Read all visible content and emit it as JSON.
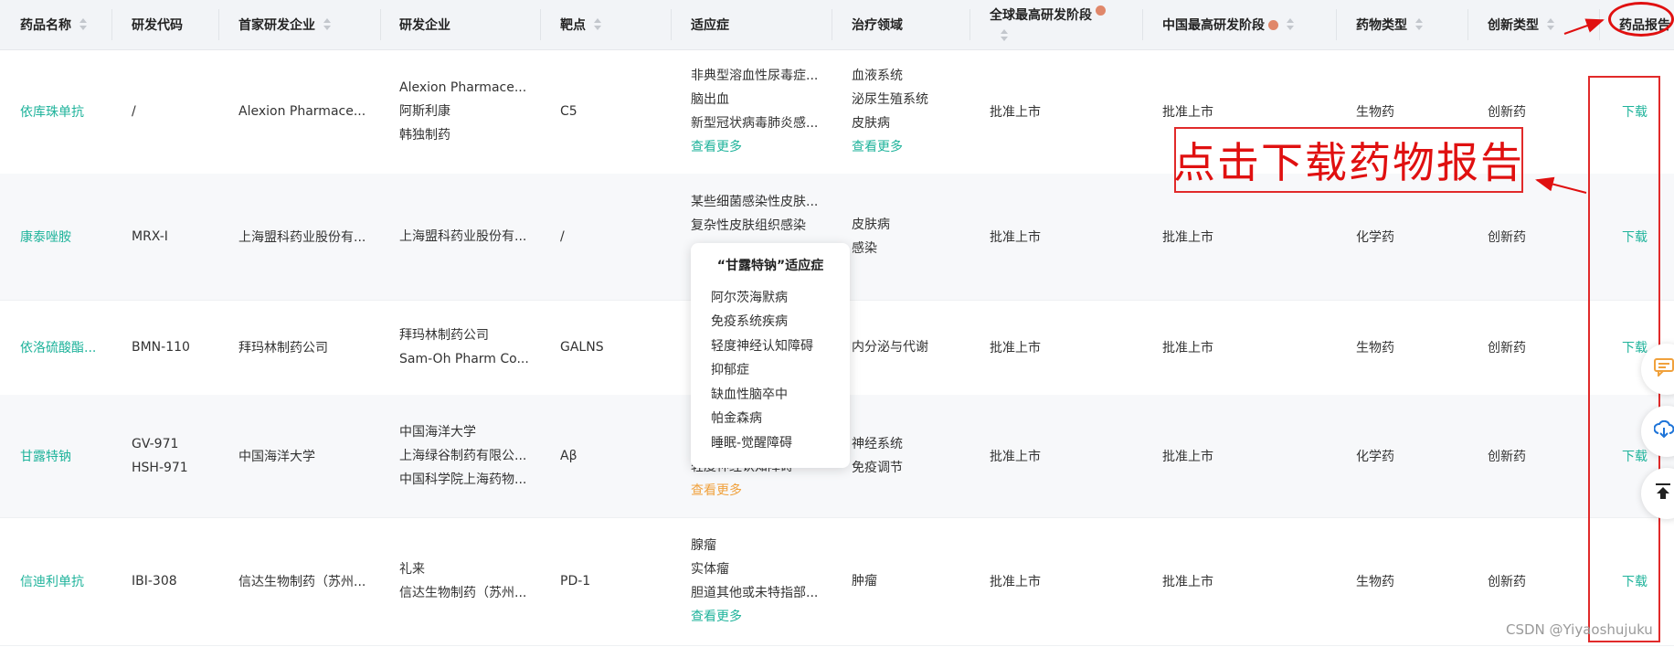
{
  "headers": {
    "name": "药品名称",
    "code": "研发代码",
    "first_company": "首家研发企业",
    "companies": "研发企业",
    "target": "靶点",
    "indication": "适应症",
    "therapy_area": "治疗领域",
    "global_stage": "全球最高研发阶段",
    "china_stage": "中国最高研发阶段",
    "drug_type": "药物类型",
    "innovation_type": "创新类型",
    "report": "药品报告"
  },
  "rows": [
    {
      "name": "依库珠单抗",
      "code": [
        "/"
      ],
      "first_company": "Alexion Pharmace...",
      "companies": [
        "Alexion Pharmace...",
        "阿斯利康",
        "韩独制药"
      ],
      "target": "C5",
      "indications": [
        "非典型溶血性尿毒症...",
        "脑出血",
        "新型冠状病毒肺炎感..."
      ],
      "indication_more": "查看更多",
      "therapy_areas": [
        "血液系统",
        "泌尿生殖系统",
        "皮肤病"
      ],
      "therapy_more": "查看更多",
      "global_stage": "批准上市",
      "china_stage": "批准上市",
      "drug_type": "生物药",
      "innovation_type": "创新药",
      "download": "下载"
    },
    {
      "name": "康泰唑胺",
      "code": [
        "MRX-I"
      ],
      "first_company": "上海盟科药业股份有...",
      "companies": [
        "上海盟科药业股份有..."
      ],
      "target": "/",
      "indications": [
        "某些细菌感染性皮肤...",
        "复杂性皮肤组织感染"
      ],
      "indication_more": "",
      "therapy_areas": [
        "皮肤病",
        "感染"
      ],
      "therapy_more": "",
      "global_stage": "批准上市",
      "china_stage": "批准上市",
      "drug_type": "化学药",
      "innovation_type": "创新药",
      "download": "下载"
    },
    {
      "name": "依洛硫酸酯...",
      "code": [
        "BMN-110"
      ],
      "first_company": "拜玛林制药公司",
      "companies": [
        "拜玛林制药公司",
        "Sam-Oh Pharm Co..."
      ],
      "target": "GALNS",
      "indications": [],
      "indication_more": "",
      "therapy_areas": [
        "内分泌与代谢"
      ],
      "therapy_more": "",
      "global_stage": "批准上市",
      "china_stage": "批准上市",
      "drug_type": "生物药",
      "innovation_type": "创新药",
      "download": "下载"
    },
    {
      "name": "甘露特钠",
      "code": [
        "GV-971",
        "HSH-971"
      ],
      "first_company": "中国海洋大学",
      "companies": [
        "中国海洋大学",
        "上海绿谷制药有限公...",
        "中国科学院上海药物..."
      ],
      "target": "Aβ",
      "indications": [
        "轻度神经认知障碍"
      ],
      "indication_more": "查看更多",
      "therapy_areas": [
        "神经系统",
        "免疫调节"
      ],
      "therapy_more": "",
      "global_stage": "批准上市",
      "china_stage": "批准上市",
      "drug_type": "化学药",
      "innovation_type": "创新药",
      "download": "下载"
    },
    {
      "name": "信迪利单抗",
      "code": [
        "IBI-308"
      ],
      "first_company": "信达生物制药（苏州...",
      "companies": [
        "礼来",
        "信达生物制药（苏州..."
      ],
      "target": "PD-1",
      "indications": [
        "腺瘤",
        "实体瘤",
        "胆道其他或未特指部..."
      ],
      "indication_more": "查看更多",
      "therapy_areas": [
        "肿瘤"
      ],
      "therapy_more": "",
      "global_stage": "批准上市",
      "china_stage": "批准上市",
      "drug_type": "生物药",
      "innovation_type": "创新药",
      "download": "下载"
    }
  ],
  "popover": {
    "title": "“甘露特钠”适应症",
    "items": [
      "阿尔茨海默病",
      "免疫系统疾病",
      "轻度神经认知障碍",
      "抑郁症",
      "缺血性脑卒中",
      "帕金森病",
      "睡眠-觉醒障碍"
    ]
  },
  "annotation": {
    "text": "点击下载药物报告",
    "color": "#e01010"
  },
  "watermark": "CSDN @Yiyaoshujuku",
  "colors": {
    "accent": "#1fb39b",
    "more_orange": "#f0a13c",
    "info_dot": "#e0876a",
    "header_bg": "#f2f4f7"
  },
  "float_icons": [
    "chat-icon",
    "download-cloud-icon",
    "back-to-top-icon"
  ]
}
